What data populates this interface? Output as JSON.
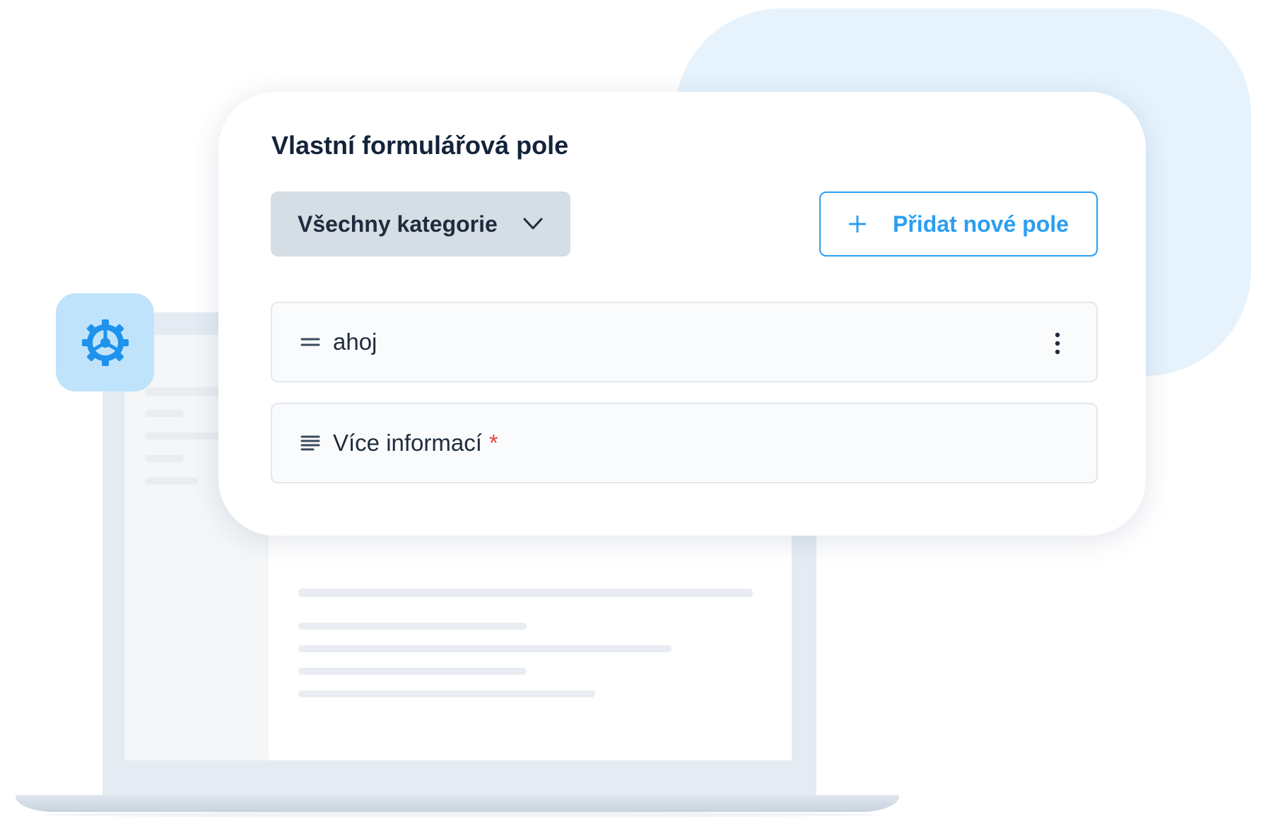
{
  "card": {
    "title": "Vlastní formulářová pole",
    "category_select": {
      "value": "Všechny kategorie",
      "icon": "chevron-down-icon"
    },
    "add_button": {
      "label": "Přidat nové pole",
      "icon": "plus-icon"
    },
    "fields": [
      {
        "name": "ahoj",
        "icon": "short-text-icon",
        "required": "",
        "menu_icon": "more-vertical-icon"
      },
      {
        "name": "Více informací",
        "icon": "long-text-icon",
        "required": "*"
      }
    ]
  },
  "badge": {
    "icon": "gear-icon"
  },
  "colors": {
    "accent": "#2b9ef0",
    "title": "#13233a",
    "required": "#e5463b",
    "select_bg": "#d5dde5",
    "badge_bg": "#bfe3fb",
    "blob_bg": "#e6f3fd"
  }
}
